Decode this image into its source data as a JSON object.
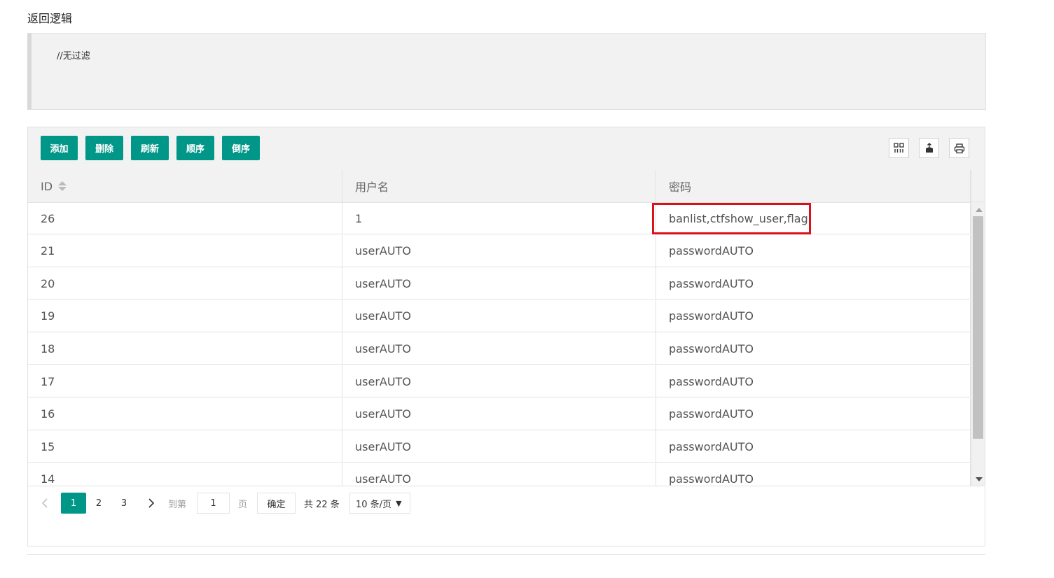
{
  "section": {
    "title": "返回逻辑",
    "code": "//无过滤"
  },
  "toolbar": {
    "buttons": [
      "添加",
      "删除",
      "刷新",
      "顺序",
      "倒序"
    ],
    "right_icons": [
      "columns-icon",
      "export-icon",
      "print-icon"
    ]
  },
  "table": {
    "columns": [
      "ID",
      "用户名",
      "密码"
    ],
    "rows": [
      [
        "26",
        "1",
        "banlist,ctfshow_user,flag"
      ],
      [
        "21",
        "userAUTO",
        "passwordAUTO"
      ],
      [
        "20",
        "userAUTO",
        "passwordAUTO"
      ],
      [
        "19",
        "userAUTO",
        "passwordAUTO"
      ],
      [
        "18",
        "userAUTO",
        "passwordAUTO"
      ],
      [
        "17",
        "userAUTO",
        "passwordAUTO"
      ],
      [
        "16",
        "userAUTO",
        "passwordAUTO"
      ],
      [
        "15",
        "userAUTO",
        "passwordAUTO"
      ],
      [
        "14",
        "userAUTO",
        "passwordAUTO"
      ]
    ]
  },
  "pager": {
    "pages": [
      "1",
      "2",
      "3"
    ],
    "goto_label": "到第",
    "goto_value": "1",
    "page_label": "页",
    "confirm": "确定",
    "total": "共 22 条",
    "per_page": "10 条/页"
  },
  "colors": {
    "primary": "#009688",
    "highlight": "#d9111b"
  }
}
